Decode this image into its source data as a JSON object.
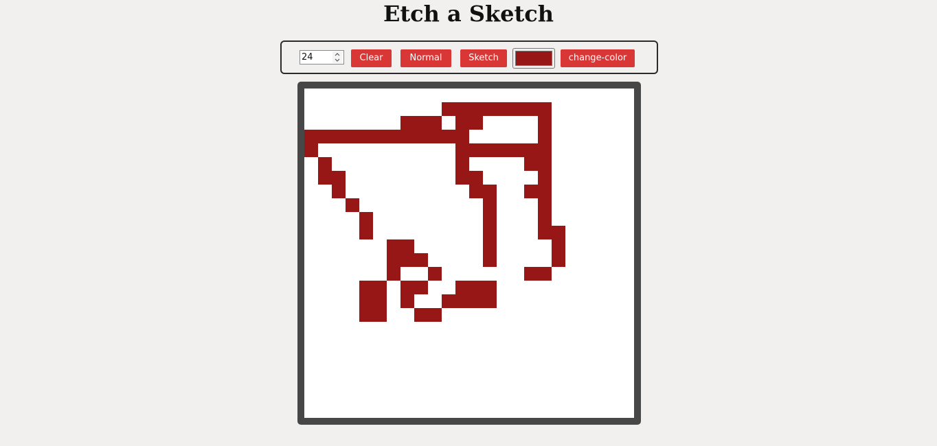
{
  "page": {
    "title": "Etch a Sketch"
  },
  "toolbar": {
    "grid_size_value": "24",
    "clear_label": "Clear",
    "normal_label": "Normal",
    "sketch_label": "Sketch",
    "change_color_label": "change-color",
    "selected_color": "#971717"
  },
  "canvas": {
    "grid_size": 24,
    "paint_color": "#971717",
    "blank_color": "#ffffff",
    "rows": [
      "........................",
      "..........xxxxxxxx......",
      ".......xxx.xx....x......",
      "xxxxxxxxxxxx.....x......",
      "x..........xxxxxxx......",
      ".x.........x....xx......",
      ".xx........xx....x......",
      "..x.........xx..xx......",
      "...x.........x...x......",
      "....x........x...x......",
      "....x........x...xx.....",
      "......xx.....x....x.....",
      "......xxx....x....x.....",
      "......x..x......xx......",
      "....xx.xx..xxx..........",
      "....xx.x..xxxx..........",
      "....xx..xx..............",
      "........................",
      "........................",
      "........................",
      "........................",
      "........................",
      "........................",
      "........................"
    ]
  }
}
